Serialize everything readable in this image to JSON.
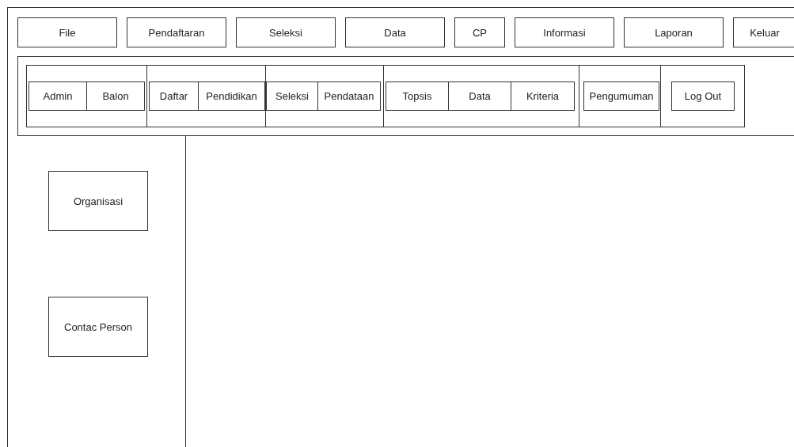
{
  "top_menu": [
    "File",
    "Pendaftaran",
    "Seleksi",
    "Data",
    "CP",
    "Informasi",
    "Laporan",
    "Keluar"
  ],
  "submenu_groups": [
    {
      "items": [
        "Admin",
        "Balon"
      ]
    },
    {
      "items": [
        "Daftar",
        "Pendidikan"
      ]
    },
    {
      "items": [
        "Seleksi",
        "Pendataan"
      ]
    },
    {
      "items": [
        "Topsis",
        "Data",
        "Kriteria"
      ]
    },
    {
      "items": [
        "Pengumuman"
      ]
    },
    {
      "items": [
        "Log Out"
      ]
    }
  ],
  "sidebar": {
    "items": [
      "Organisasi",
      "Contac Person"
    ]
  }
}
